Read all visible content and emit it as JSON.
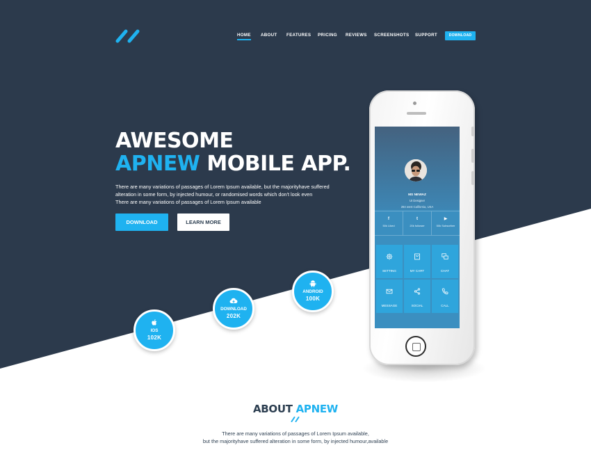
{
  "colors": {
    "dark": "#2c3a4c",
    "accent": "#1fb2f0",
    "white": "#ffffff"
  },
  "header": {
    "logo_icon": "double-slash-logo",
    "nav": [
      {
        "label": "HOME",
        "active": true
      },
      {
        "label": "ABOUT"
      },
      {
        "label": "FEATURES"
      },
      {
        "label": "PRICING"
      },
      {
        "label": "REVIEWS"
      },
      {
        "label": "SCREENSHOTS"
      },
      {
        "label": "SUPPORT"
      }
    ],
    "download_label": "DOWNLOAD"
  },
  "hero": {
    "title_line1": "AWESOME",
    "title_accent": "APNEW",
    "title_rest": " MOBILE APP.",
    "description_line1": "There are many variations of passages of Lorem Ipsum available, but the majorityhave suffered",
    "description_line2": "alteration in some form, by injected humour, or randomised words which don't look even",
    "description_line3": "There are many variations of passages of Lorem Ipsum available",
    "download_button": "DOWNLOAD",
    "learn_button": "LEARN MORE"
  },
  "stats": [
    {
      "icon": "apple-icon",
      "label": "IOS",
      "value": "102K"
    },
    {
      "icon": "cloud-download-icon",
      "label": "DOWNLOAD",
      "value": "202K"
    },
    {
      "icon": "android-icon",
      "label": "ANDROID",
      "value": "100K"
    }
  ],
  "phone_screen": {
    "name": "MS NEWAZ",
    "role": "UI Designer",
    "location": "284 west California, USA",
    "social": [
      {
        "glyph": "f",
        "text": "50k Liked"
      },
      {
        "glyph": "t",
        "text": "20k follower"
      },
      {
        "glyph": "▶",
        "text": "50k Subscriber"
      }
    ],
    "tiles": [
      {
        "icon": "gear-icon",
        "label": "SETTING"
      },
      {
        "icon": "cart-icon",
        "label": "MY CART"
      },
      {
        "icon": "chat-icon",
        "label": "CHAT"
      },
      {
        "icon": "envelope-icon",
        "label": "MESSAGE"
      },
      {
        "icon": "share-icon",
        "label": "SOCIAL"
      },
      {
        "icon": "phone-icon",
        "label": "CALL"
      }
    ]
  },
  "about": {
    "title": "ABOUT",
    "title_accent": "APNEW",
    "line1": "There are many variations of passages of Lorem Ipsum available,",
    "line2": "but the majorityhave suffered alteration in some form, by injected humour,available"
  }
}
